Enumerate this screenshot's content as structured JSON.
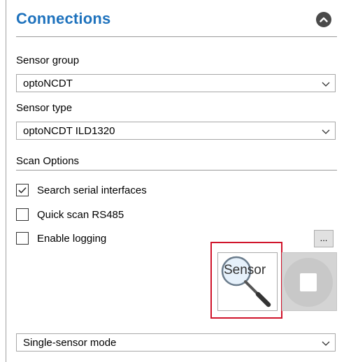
{
  "header": {
    "title": "Connections",
    "collapse_icon": "chevron-up-icon"
  },
  "sensor_group": {
    "label": "Sensor group",
    "value": "optoNCDT"
  },
  "sensor_type": {
    "label": "Sensor type",
    "value": "optoNCDT ILD1320"
  },
  "scan_options": {
    "label": "Scan Options",
    "checkboxes": [
      {
        "label": "Search serial interfaces",
        "checked": true
      },
      {
        "label": "Quick scan RS485",
        "checked": false
      },
      {
        "label": "Enable logging",
        "checked": false
      }
    ],
    "logging_browse_label": "...",
    "scan_button_text": "Sensor",
    "scan_icon": "magnifier-icon",
    "stop_icon": "stop-icon"
  },
  "mode": {
    "value": "Single-sensor mode"
  },
  "colors": {
    "title": "#1e72bd",
    "highlight": "#d0142b",
    "stop_disabled": "#c8c8c8"
  }
}
